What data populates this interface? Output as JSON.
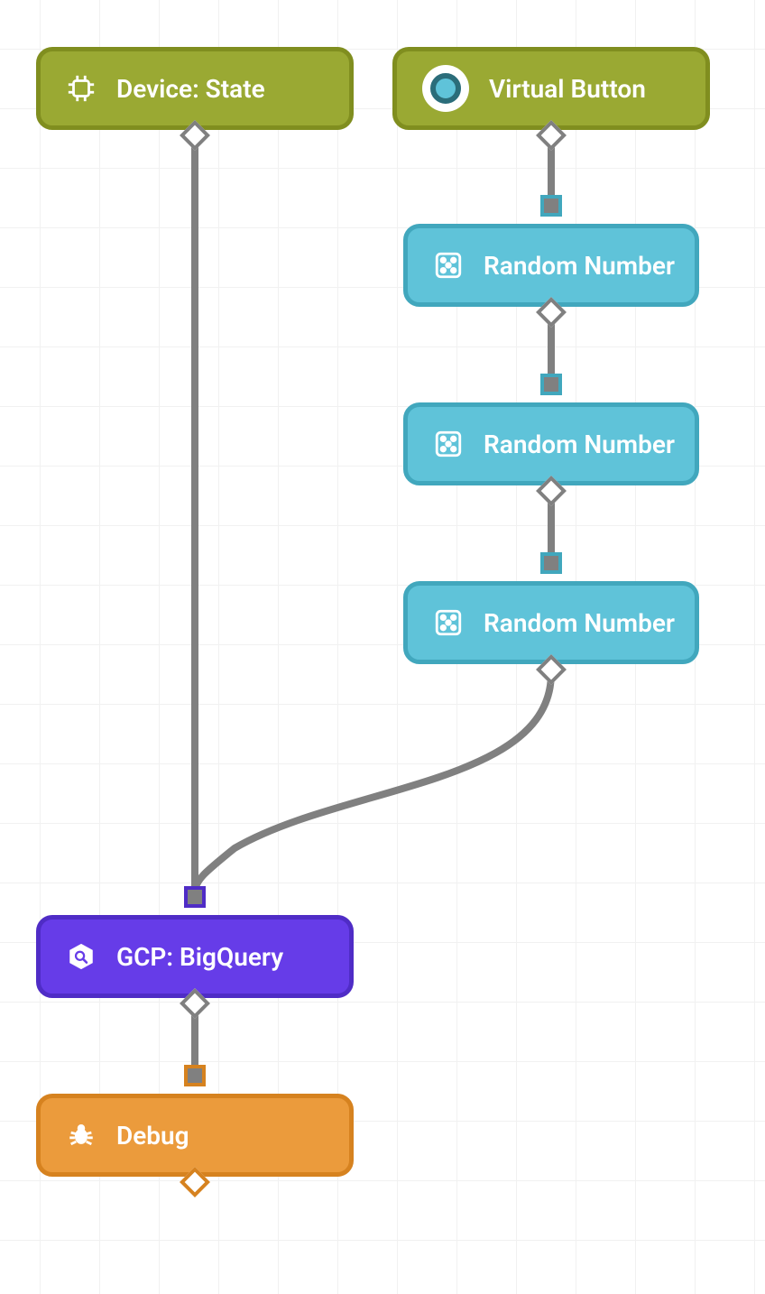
{
  "nodes": {
    "device_state": {
      "label": "Device: State",
      "icon": "chip-icon"
    },
    "virtual_button": {
      "label": "Virtual Button",
      "icon": "virtual-button-icon"
    },
    "random1": {
      "label": "Random Number",
      "icon": "dice-icon"
    },
    "random2": {
      "label": "Random Number",
      "icon": "dice-icon"
    },
    "random3": {
      "label": "Random Number",
      "icon": "dice-icon"
    },
    "bigquery": {
      "label": "GCP: BigQuery",
      "icon": "bigquery-icon"
    },
    "debug": {
      "label": "Debug",
      "icon": "bug-icon"
    }
  },
  "colors": {
    "olive": "#9aa933",
    "teal": "#5fc3d9",
    "violet": "#663ce8",
    "orange": "#eb9b3c",
    "edge": "#808080"
  },
  "edges": [
    {
      "from": "device_state",
      "to": "bigquery"
    },
    {
      "from": "virtual_button",
      "to": "random1"
    },
    {
      "from": "random1",
      "to": "random2"
    },
    {
      "from": "random2",
      "to": "random3"
    },
    {
      "from": "random3",
      "to": "bigquery"
    },
    {
      "from": "bigquery",
      "to": "debug"
    }
  ]
}
